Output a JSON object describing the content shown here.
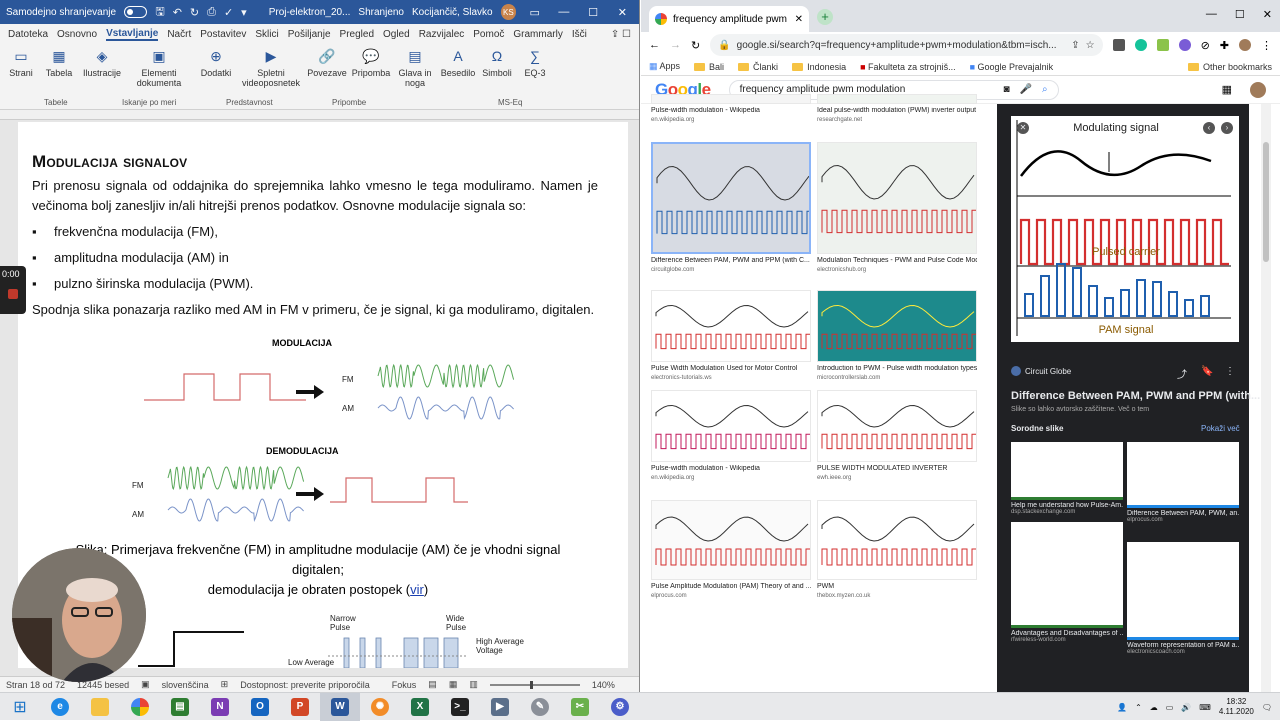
{
  "word": {
    "autosave_label": "Samodejno shranjevanje",
    "doc_title": "Proj-elektron_20...",
    "save_state": "Shranjeno",
    "user_name": "Kocijančič, Slavko",
    "user_initials": "KS",
    "tabs": [
      "Datoteka",
      "Osnovno",
      "Vstavljanje",
      "Načrt",
      "Postavitev",
      "Sklici",
      "Pošiljanje",
      "Pregled",
      "Ogled",
      "Razvijalec",
      "Pomoč",
      "Grammarly",
      "Išči"
    ],
    "active_tab": "Vstavljanje",
    "ribbon": [
      {
        "label": "Strani",
        "icon": "pages-icon"
      },
      {
        "label": "Tabela",
        "icon": "table-icon"
      },
      {
        "label": "Ilustracije",
        "icon": "illustrations-icon"
      },
      {
        "label": "Elementi dokumenta",
        "icon": "document-elements-icon"
      },
      {
        "label": "Dodatki",
        "icon": "addins-icon"
      },
      {
        "label": "Spletni videoposnetek",
        "icon": "online-video-icon"
      },
      {
        "label": "Povezave",
        "icon": "links-icon"
      },
      {
        "label": "Pripomba",
        "icon": "comment-icon"
      },
      {
        "label": "Glava in noga",
        "icon": "header-footer-icon"
      },
      {
        "label": "Besedilo",
        "icon": "text-icon"
      },
      {
        "label": "Simboli",
        "icon": "symbols-icon"
      },
      {
        "label": "EQ-3",
        "icon": "equation-icon"
      }
    ],
    "ribbon_groups": [
      "Tabele",
      "Iskanje po meri",
      "Predstavnost",
      "Pripombe",
      "MS-Eq"
    ],
    "heading": "Modulacija signalov",
    "paragraph1": "Pri prenosu signala od oddajnika do sprejemnika lahko vmesno le tega moduliramo. Namen je večinoma bolj zanesljiv in/ali hitrejši prenos podatkov. Osnovne modulacije signala so:",
    "bullets": [
      "frekvenčna modulacija (FM),",
      "amplitudna modulacija  (AM) in",
      "pulzno širinska modulacija (PWM)."
    ],
    "paragraph2": "Spodnja slika ponazarja razliko med AM in FM v primeru, če je signal, ki ga moduliramo, digitalen.",
    "figure": {
      "mod_title": "MODULACIJA",
      "demod_title": "DEMODULACIJA",
      "fm": "FM",
      "am": "AM"
    },
    "caption_line1": "Slika: Primerjava frekvenčne (FM) in amplitudne modulacije (AM) če je vhodni signal digitalen;",
    "caption_line2": "demodulacija je obraten postopek (",
    "caption_link": "vir",
    "caption_end": ")",
    "pwm_fig": {
      "narrow": "Narrow Pulse",
      "wide": "Wide Pulse",
      "high": "High Average Voltage",
      "low": "Low Average"
    },
    "status": {
      "page": "Stran 18 od 72",
      "words": "12445 besed",
      "lang": "slovenščina",
      "access": "Dostopnost: preverite priporočila",
      "focus": "Fokus",
      "zoom": "140%"
    },
    "recording_time": "0:00"
  },
  "chrome": {
    "tab_title": "frequency amplitude pwm modu",
    "url": "google.si/search?q=frequency+amplitude+pwm+modulation&tbm=isch...",
    "bookmarks": [
      "Apps",
      "Bali",
      "Članki",
      "Indonesia",
      "Fakulteta za strojniš...",
      "Google Prevajalnik",
      "Other bookmarks"
    ],
    "logo": "Google",
    "query": "frequency amplitude pwm modulation",
    "results": [
      {
        "title": "Pulse-width modulation - Wikipedia",
        "source": "en.wikipedia.org"
      },
      {
        "title": "Ideal pulse-width modulation (PWM) inverter output vo...",
        "source": "researchgate.net"
      },
      {
        "title": "Difference Between PAM, PWM and PPM (with C...",
        "source": "circuitglobe.com"
      },
      {
        "title": "Modulation Techniques - PWM and Pulse Code Modul...",
        "source": "electronicshub.org"
      },
      {
        "title": "Pulse Width Modulation Used for Motor Control",
        "source": "electronics-tutorials.ws"
      },
      {
        "title": "Introduction to PWM - Pulse width modulation types",
        "source": "microcontrollerslab.com"
      },
      {
        "title": "Pulse-width modulation - Wikipedia",
        "source": "en.wikipedia.org"
      },
      {
        "title": "PULSE WIDTH MODULATED INVERTER",
        "source": "ewh.ieee.org"
      },
      {
        "title": "Pulse Amplitude Modulation (PAM) Theory of and ...",
        "source": "elprocus.com"
      },
      {
        "title": "PWM",
        "source": "thebox.myzen.co.uk"
      }
    ],
    "panel": {
      "modulating": "Modulating signal",
      "pulsed": "Pulsed carrier",
      "pam": "PAM signal",
      "site": "Circuit Globe",
      "title": "Difference Between PAM, PWM and PPM (with...",
      "copyright": "Slike so lahko avtorsko zaščitene. Več o tem",
      "related": "Sorodne slike",
      "show_all": "Pokaži več",
      "related_items": [
        {
          "title": "Help me understand how Pulse-Am...",
          "source": "dsp.stackexchange.com"
        },
        {
          "title": "Difference Between PAM, PWM, an...",
          "source": "elprocus.com"
        },
        {
          "title": "Advantages and Disadvantages of ...",
          "source": "rfwireless-world.com"
        },
        {
          "title": "Waveform representation of PAM a...",
          "source": "electronicscoach.com"
        }
      ]
    }
  },
  "taskbar": {
    "time": "18:32",
    "date": "4.11.2020"
  }
}
